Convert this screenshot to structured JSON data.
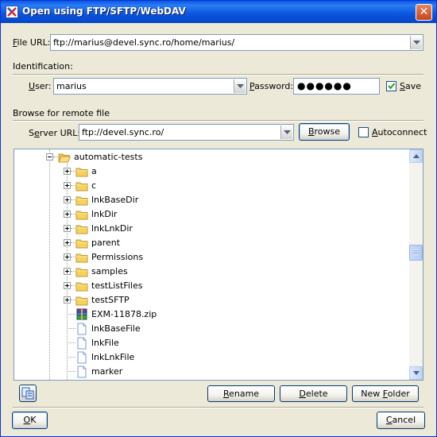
{
  "window": {
    "title": "Open using FTP/SFTP/WebDAV",
    "close_glyph": "✕"
  },
  "file_url": {
    "label_key": "F",
    "label_rest": "ile URL:",
    "value": "ftp://marius@devel.sync.ro/home/marius/"
  },
  "identification": {
    "header": "Identification:",
    "user_label_key": "U",
    "user_label_rest": "ser:",
    "user_value": "marius",
    "password_label_key": "P",
    "password_label_rest": "assword:",
    "password_masked": "●●●●●●",
    "save_label_key": "S",
    "save_label_rest": "ave",
    "save_checked": true
  },
  "browse": {
    "header": "Browse for remote file",
    "server_label_pre": "S",
    "server_label_key": "e",
    "server_label_rest": "rver URL:",
    "server_value": "ftp://devel.sync.ro/",
    "browse_button_key": "B",
    "browse_button_rest": "rowse",
    "autoconnect_key": "A",
    "autoconnect_rest": "utoconnect",
    "autoconnect_checked": false
  },
  "tree": {
    "items": [
      {
        "label": "automatic-tests",
        "type": "folder",
        "expanded": true
      },
      {
        "label": "a",
        "type": "folder"
      },
      {
        "label": "c",
        "type": "folder"
      },
      {
        "label": "lnkBaseDir",
        "type": "folder"
      },
      {
        "label": "lnkDir",
        "type": "folder"
      },
      {
        "label": "lnkLnkDir",
        "type": "folder"
      },
      {
        "label": "parent",
        "type": "folder"
      },
      {
        "label": "Permissions",
        "type": "folder"
      },
      {
        "label": "samples",
        "type": "folder"
      },
      {
        "label": "testListFiles",
        "type": "folder"
      },
      {
        "label": "testSFTP",
        "type": "folder"
      },
      {
        "label": "EXM-11878.zip",
        "type": "archive"
      },
      {
        "label": "lnkBaseFile",
        "type": "file"
      },
      {
        "label": "lnkFile",
        "type": "file"
      },
      {
        "label": "lnkLnkFile",
        "type": "file"
      },
      {
        "label": "marker",
        "type": "file"
      }
    ]
  },
  "actions": {
    "rename_key": "R",
    "rename_rest": "ename",
    "delete_key": "D",
    "delete_rest": "elete",
    "newfolder_pre": "New ",
    "newfolder_key": "F",
    "newfolder_rest": "older"
  },
  "footer": {
    "ok_key": "O",
    "ok_rest": "K",
    "cancel_key": "C",
    "cancel_rest": "ancel"
  },
  "icons": {
    "app": "oxygen-app-icon",
    "folder": "folder-icon",
    "file": "file-icon",
    "archive": "zip-archive-icon",
    "view_toggle": "view-mode-icon"
  },
  "colors": {
    "titlebar": "#0a58e4",
    "dialog_bg": "#ece9d8",
    "folder": "#f5d25f",
    "border": "#7f9db9"
  }
}
